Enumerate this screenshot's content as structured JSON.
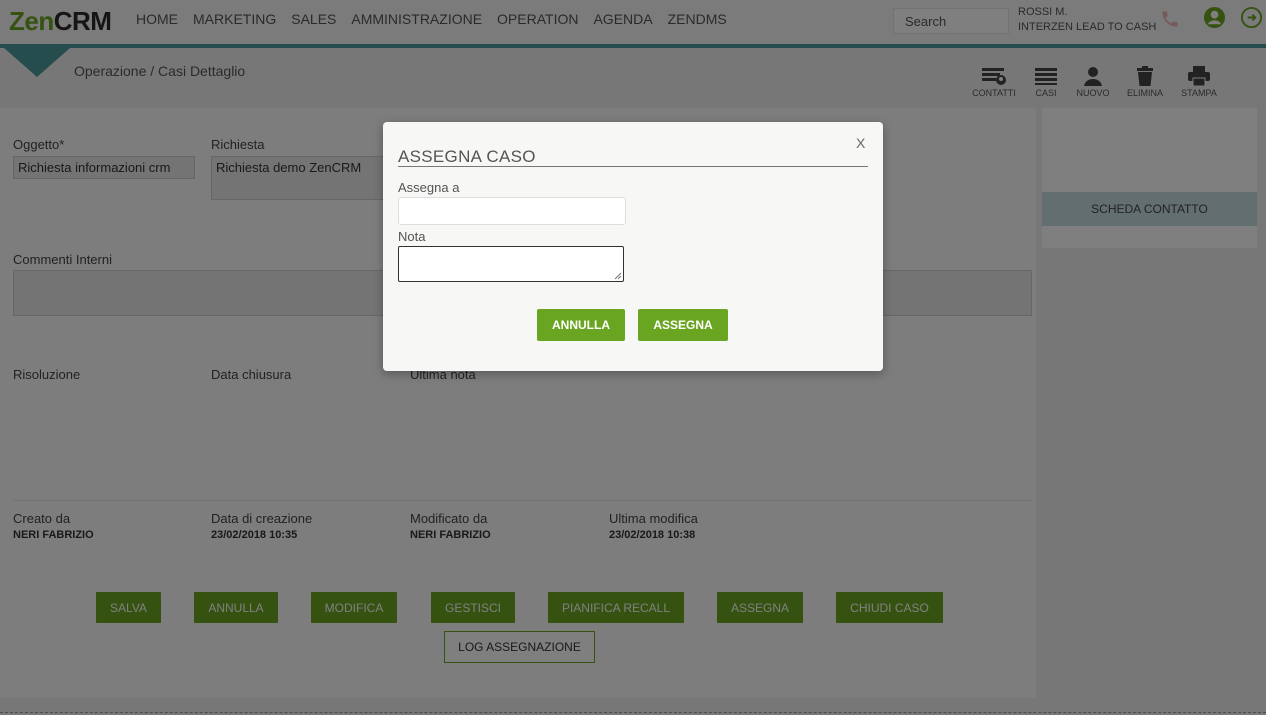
{
  "logo": {
    "part1": "Zen",
    "part2": "CRM"
  },
  "nav": [
    "HOME",
    "MARKETING",
    "SALES",
    "AMMINISTRAZIONE",
    "OPERATION",
    "AGENDA",
    "ZENDMS"
  ],
  "search": {
    "label": "Search"
  },
  "user": {
    "name": "ROSSI M.",
    "company": "INTERZEN LEAD TO CASH"
  },
  "breadcrumb": "Operazione / Casi Dettaglio",
  "toolbar": {
    "contatti": "CONTATTI",
    "casi": "CASI",
    "nuovo": "NUOVO",
    "elimina": "ELIMINA",
    "stampa": "STAMPA"
  },
  "form": {
    "oggetto_label": "Oggetto*",
    "oggetto_value": "Richiesta informazioni crm",
    "richiesta_label": "Richiesta",
    "richiesta_value": "Richiesta demo ZenCRM",
    "commenti_label": "Commenti Interni",
    "risoluzione_label": "Risoluzione",
    "data_chiusura_label": "Data chiusura",
    "ultima_nota_label": "Ultima nota",
    "creato_da_label": "Creato da",
    "creato_da_value": "NERI FABRIZIO",
    "data_creazione_label": "Data di creazione",
    "data_creazione_value": "23/02/2018 10:35",
    "modificato_da_label": "Modificato da",
    "modificato_da_value": "NERI FABRIZIO",
    "ultima_modifica_label": "Ultima modifica",
    "ultima_modifica_value": "23/02/2018 10:38"
  },
  "side": {
    "scheda_contatto": "SCHEDA CONTATTO"
  },
  "actions": {
    "salva": "SALVA",
    "annulla": "ANNULLA",
    "modifica": "MODIFICA",
    "gestisci": "GESTISCI",
    "pianifica": "PIANIFICA RECALL",
    "assegna": "ASSEGNA",
    "chiudi": "CHIUDI CASO",
    "log": "LOG ASSEGNAZIONE"
  },
  "modal": {
    "title": "ASSEGNA CASO",
    "close": "X",
    "assegna_label": "Assegna a",
    "assegna_value": "",
    "nota_label": "Nota",
    "nota_value": "",
    "annulla": "ANNULLA",
    "assegna": "ASSEGNA"
  },
  "colors": {
    "brand_green": "#6aa522",
    "teal": "#4a9a9b"
  }
}
